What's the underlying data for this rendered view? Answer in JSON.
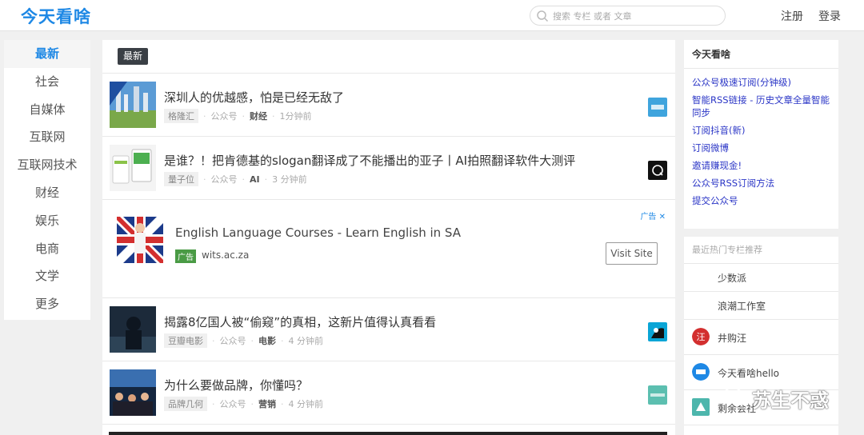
{
  "header": {
    "logo": "今天看啥",
    "search_placeholder": "搜索 专栏 或者 文章",
    "register": "注册",
    "login": "登录"
  },
  "nav": {
    "items": [
      "最新",
      "社会",
      "自媒体",
      "互联网",
      "互联网技术",
      "财经",
      "娱乐",
      "电商",
      "文学",
      "更多"
    ],
    "active": "最新"
  },
  "feed": {
    "badge": "最新",
    "articles": [
      {
        "title": "深圳人的优越感，怕是已经无敌了",
        "source": "格隆汇",
        "type": "公众号",
        "category": "财经",
        "time": "1分钟前"
      },
      {
        "title": "是谁？！把肯德基的slogan翻译成了不能播出的亚子丨AI拍照翻译软件大测评",
        "source": "量子位",
        "type": "公众号",
        "category": "AI",
        "time": "3 分钟前"
      },
      {
        "title": "揭露8亿国人被“偷窥”的真相，这新片值得认真看看",
        "source": "豆瓣电影",
        "type": "公众号",
        "category": "电影",
        "time": "4 分钟前"
      },
      {
        "title": "为什么要做品牌，你懂吗？",
        "source": "品牌几何",
        "type": "公众号",
        "category": "营销",
        "time": "4 分钟前"
      }
    ],
    "ad": {
      "title": "English Language Courses - Learn English in SA",
      "label": "广告",
      "url": "wits.ac.za",
      "corner": "广告 ✕",
      "button": "Visit Site"
    }
  },
  "sidebar": {
    "title": "今天看啥",
    "links": [
      "公众号极速订阅(分钟级)",
      "智能RSS链接 - 历史文章全量智能同步",
      "订阅抖音(新)",
      "订阅微博",
      "邀请赚现金!",
      "公众号RSS订阅方法",
      "提交公众号"
    ],
    "columns_title": "最近热门专栏推荐",
    "columns": [
      "少数派",
      "浪潮工作室",
      "井购汪",
      "今天看啥hello",
      "剩余会社"
    ]
  },
  "watermark": "苏生不惑",
  "colors": {
    "brand": "#1e88e5",
    "link": "#2a35c6",
    "ad_green": "#4a9b45"
  }
}
